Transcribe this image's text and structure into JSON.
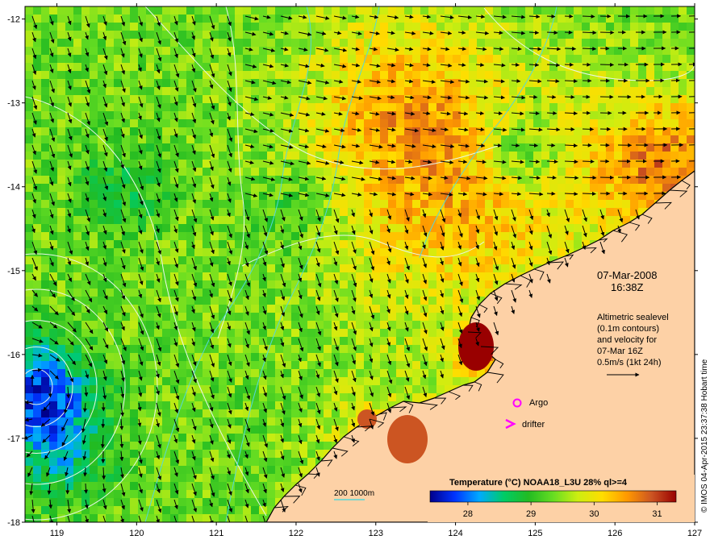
{
  "map": {
    "lon_ticks": [
      "119",
      "120",
      "121",
      "122",
      "123",
      "124",
      "125",
      "126",
      "127"
    ],
    "lat_ticks": [
      "-12",
      "-13",
      "-14",
      "-15",
      "-16",
      "-17",
      "-18"
    ],
    "colors": {
      "land": "#fdd1a6",
      "coast": "#000000",
      "sea_ramp": [
        "#00008b",
        "#0033ff",
        "#00aaff",
        "#00cc66",
        "#22bb22",
        "#66dd22",
        "#ccee11",
        "#ffdd00",
        "#ff9900",
        "#cc5522",
        "#990000"
      ],
      "contour": "#e8f7e8",
      "isobath": "#55d8d8",
      "argo": "#ff00ff",
      "drifter": "#ff00ff"
    }
  },
  "annotation": {
    "date": "07-Mar-2008",
    "time": "16:38Z",
    "info_line1": "Altimetric sealevel",
    "info_line2": "(0.1m contours)",
    "info_line3": "and velocity for",
    "info_line4": "07-Mar 16Z",
    "info_line5": "0.5m/s (1kt 24h)"
  },
  "legend": {
    "argo": "Argo",
    "drifter": "drifter",
    "isobath": "200  1000m"
  },
  "colorbar": {
    "title": "Temperature (°C) NOAA18_L3U 28% ql>=4",
    "ticks": [
      "28",
      "29",
      "30",
      "31"
    ],
    "range": [
      27.4,
      31.3
    ]
  },
  "credit": "© IMOS 04-Apr-2015 23:37:38 Hobart time"
}
